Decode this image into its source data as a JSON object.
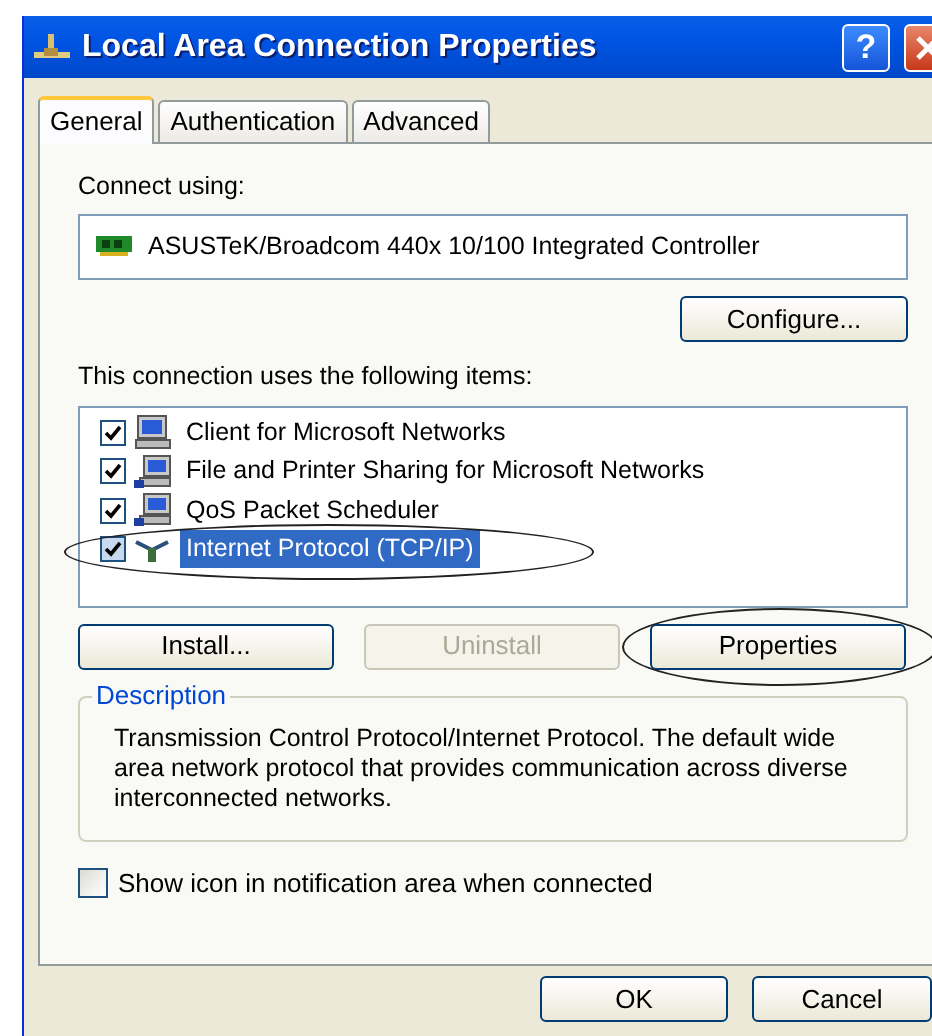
{
  "window": {
    "title": "Local Area Connection Properties",
    "help_button": "?"
  },
  "tabs": [
    {
      "label": "General",
      "selected": true
    },
    {
      "label": "Authentication",
      "selected": false
    },
    {
      "label": "Advanced",
      "selected": false
    }
  ],
  "connect_using": {
    "label": "Connect using:",
    "adapter": "ASUSTeK/Broadcom 440x 10/100 Integrated Controller",
    "button": "Configure..."
  },
  "components": {
    "label": "This connection uses the following items:",
    "items": [
      {
        "kind": "client",
        "label": "Client for Microsoft Networks",
        "checked": true,
        "selected": false,
        "circled": false
      },
      {
        "kind": "service",
        "label": "File and Printer Sharing for Microsoft Networks",
        "checked": true,
        "selected": false,
        "circled": false
      },
      {
        "kind": "service",
        "label": "QoS Packet Scheduler",
        "checked": true,
        "selected": false,
        "circled": false
      },
      {
        "kind": "protocol",
        "label": "Internet Protocol (TCP/IP)",
        "checked": true,
        "selected": true,
        "circled": true
      }
    ],
    "buttons": [
      {
        "label": "Install...",
        "disabled": false,
        "circled": false
      },
      {
        "label": "Uninstall",
        "disabled": true,
        "circled": false
      },
      {
        "label": "Properties",
        "disabled": false,
        "circled": true
      }
    ]
  },
  "description": {
    "legend": "Description",
    "text": "Transmission Control Protocol/Internet Protocol. The default wide area network protocol that provides communication across diverse interconnected networks."
  },
  "notification_option": {
    "label": "Show icon in notification area when connected",
    "checked": false
  },
  "footer_buttons": [
    "OK",
    "Cancel"
  ]
}
